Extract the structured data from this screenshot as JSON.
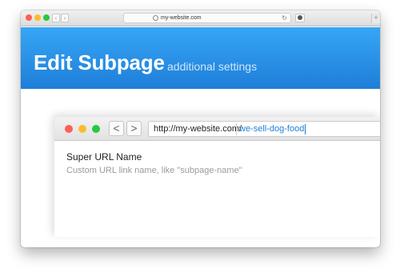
{
  "window": {
    "url": "my-website.com",
    "colors": {
      "close": "#fc5f57",
      "minimize": "#fdbc2e",
      "zoom": "#28c840"
    }
  },
  "header": {
    "title": "Edit Subpage",
    "subtitle": "additional settings"
  },
  "inner": {
    "back_glyph": "<",
    "forward_glyph": ">",
    "url_prefix": "http://my-website.com/",
    "url_slug": "we-sell-dog-food"
  },
  "field": {
    "label": "Super URL Name",
    "help": "Custom URL link name, like \"subpage-name\""
  },
  "toolbar": {
    "back_glyph": "‹",
    "forward_glyph": "›",
    "reload_glyph": "↻",
    "new_tab_glyph": "+"
  },
  "accent": "#1e7ed8"
}
